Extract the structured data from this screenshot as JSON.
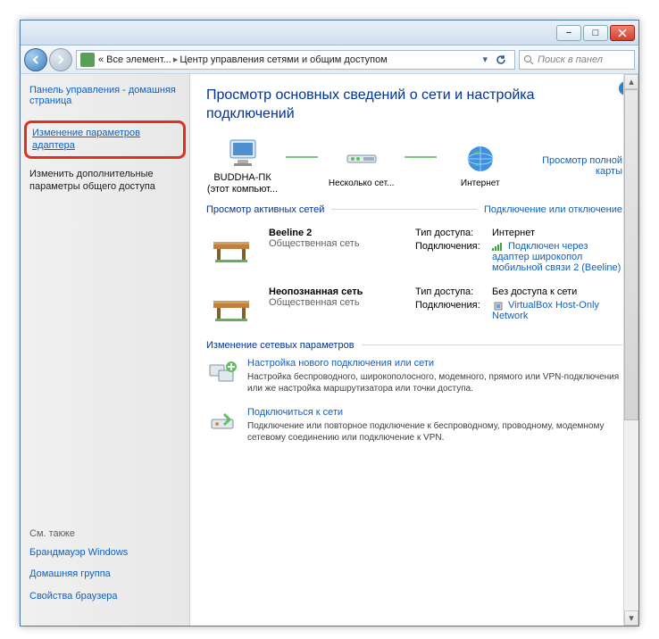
{
  "titlebar": {
    "min": "−",
    "max": "□",
    "close": "×"
  },
  "addr": {
    "back_dir": "left",
    "fwd_dir": "right",
    "bc1": "« Все элемент...",
    "bc2": "Центр управления сетями и общим доступом",
    "search_ph": "Поиск в панел"
  },
  "sidebar": {
    "home": "Панель управления - домашняя страница",
    "link1": "Изменение параметров адаптера",
    "link2": "Изменить дополнительные параметры общего доступа",
    "seealso": "См. также",
    "sa1": "Брандмауэр Windows",
    "sa2": "Домашняя группа",
    "sa3": "Свойства браузера"
  },
  "main": {
    "help": "?",
    "h1": "Просмотр основных сведений о сети и настройка подключений",
    "map": {
      "n1": "BUDDHA-ПК",
      "n1b": "(этот компьют...",
      "n2": "Несколько сет...",
      "n3": "Интернет",
      "fullmap": "Просмотр полной карты"
    },
    "sec_active": "Просмотр активных сетей",
    "conn_toggle": "Подключение или отключение",
    "net1": {
      "name": "Beeline 2",
      "type": "Общественная сеть",
      "k1": "Тип доступа:",
      "v1": "Интернет",
      "k2": "Подключения:",
      "v2": "Подключен через адаптер широкопол мобильной связи 2 (Beeline)"
    },
    "net2": {
      "name": "Неопознанная сеть",
      "type": "Общественная сеть",
      "k1": "Тип доступа:",
      "v1": "Без доступа к сети",
      "k2": "Подключения:",
      "v2": "VirtualBox Host-Only Network"
    },
    "sec_change": "Изменение сетевых параметров",
    "t1": {
      "title": "Настройка нового подключения или сети",
      "desc": "Настройка беспроводного, широкополосного, модемного, прямого или VPN-подключения или же настройка маршрутизатора или точки доступа."
    },
    "t2": {
      "title": "Подключиться к сети",
      "desc": "Подключение или повторное подключение к беспроводному, проводному, модемному сетевому соединению или подключение к VPN."
    }
  }
}
